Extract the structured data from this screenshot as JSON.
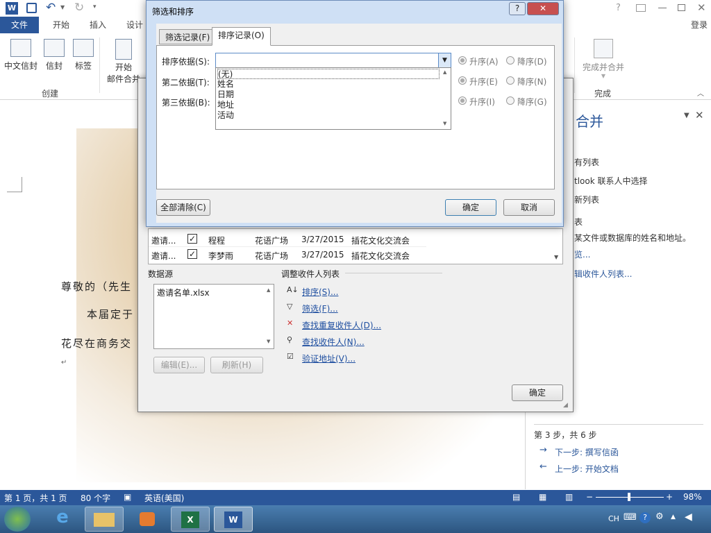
{
  "app": {
    "tabs": [
      "文件",
      "开始",
      "插入",
      "设计"
    ],
    "login": "登录",
    "help": "?"
  },
  "ribbon": {
    "buttons": [
      "中文信封",
      "信封",
      "标签",
      "开始",
      "邮件合并"
    ],
    "group_create": "创建",
    "finish_label1": "完成并合并",
    "group_finish": "完成"
  },
  "document": {
    "line1": "尊敬的（先生",
    "line2": "本届定于",
    "line3": "花尽在商务交",
    "para_mark": "↵"
  },
  "taskpane": {
    "title_partial": "合并",
    "opt1": "有列表",
    "opt2": "tlook 联系人中选择",
    "opt3": "新列表",
    "section": "表",
    "desc": "某文件或数据库的姓名和地址。",
    "link_browse": "览...",
    "link_edit": "辑收件人列表...",
    "step": "第 3 步，共 6 步",
    "next": "下一步: 撰写信函",
    "prev": "上一步: 开始文档"
  },
  "statusbar": {
    "page": "第 1 页，共 1 页",
    "words": "80 个字",
    "lang": "英语(美国)",
    "zoom": "98%"
  },
  "taskbar": {
    "lang": "CH"
  },
  "recipients": {
    "rows": [
      {
        "src": "邀请...",
        "checked": true,
        "name": "程程",
        "place": "花语广场",
        "date": "3/27/2015",
        "event": "插花文化交流会"
      },
      {
        "src": "邀请...",
        "checked": true,
        "name": "李梦雨",
        "place": "花语广场",
        "date": "3/27/2015",
        "event": "插花文化交流会"
      }
    ],
    "datasource_label": "数据源",
    "datasource_file": "邀请名单.xlsx",
    "edit_btn": "编辑(E)...",
    "refresh_btn": "刷新(H)",
    "adjust_label": "调整收件人列表",
    "links": [
      "排序(S)...",
      "筛选(F)...",
      "查找重复收件人(D)...",
      "查找收件人(N)...",
      "验证地址(V)..."
    ],
    "ok": "确定"
  },
  "filter_sort": {
    "title": "筛选和排序",
    "tab_filter": "筛选记录(F)",
    "tab_sort": "排序记录(O)",
    "sort_by": "排序依据(S):",
    "then_by": "第二依据(T):",
    "then_by2": "第三依据(B):",
    "dropdown_options": [
      "(无)",
      "姓名",
      "日期",
      "地址",
      "活动"
    ],
    "asc1": "升序(A)",
    "desc1": "降序(D)",
    "asc2": "升序(E)",
    "desc2": "降序(N)",
    "asc3": "升序(I)",
    "desc3": "降序(G)",
    "clear_all": "全部清除(C)",
    "ok": "确定",
    "cancel": "取消"
  }
}
